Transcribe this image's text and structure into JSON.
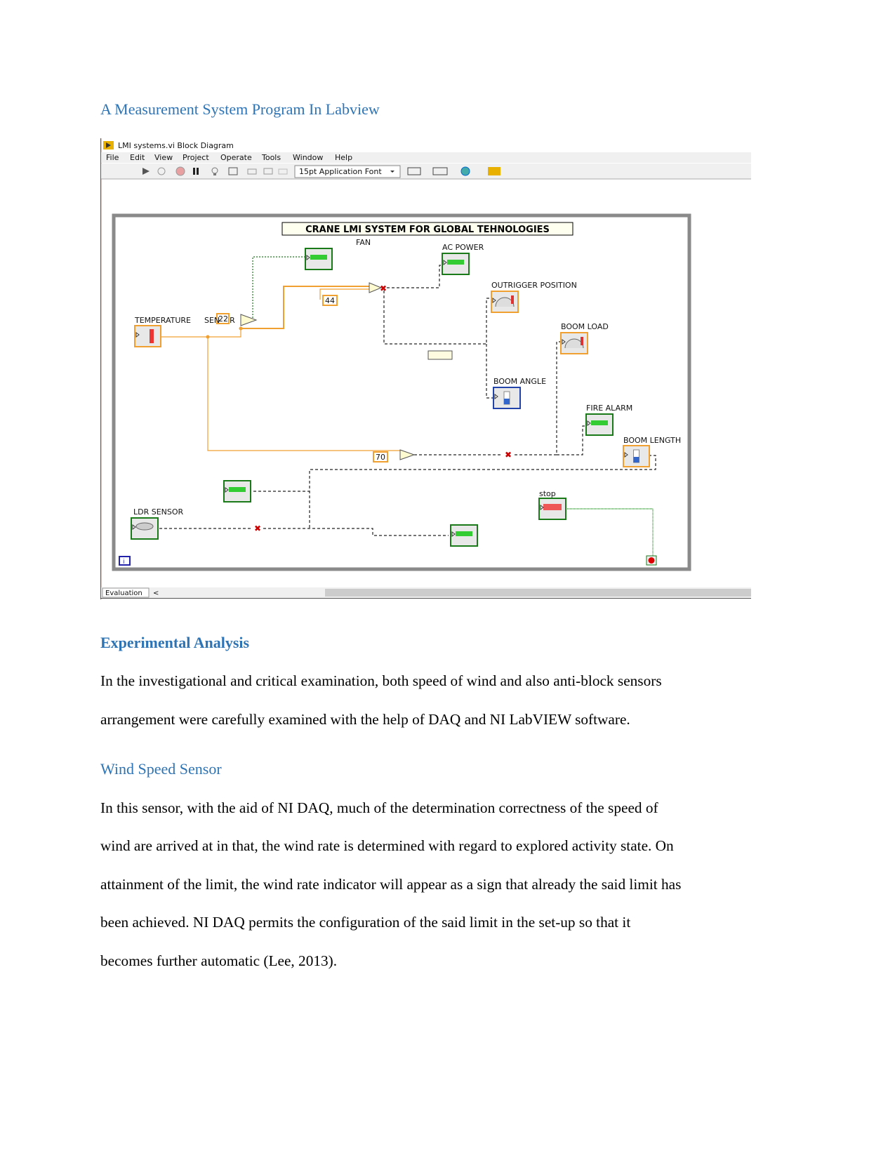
{
  "headings": {
    "main": "A Measurement System Program In Labview",
    "experimental": "Experimental Analysis",
    "wind": "Wind Speed Sensor"
  },
  "labview": {
    "window_title": "LMI systems.vi Block Diagram",
    "menu": [
      "File",
      "Edit",
      "View",
      "Project",
      "Operate",
      "Tools",
      "Window",
      "Help"
    ],
    "font_select": "15pt Application Font",
    "diagram_title": "CRANE LMI SYSTEM FOR GLOBAL TEHNOLOGIES",
    "labels": {
      "fan": "FAN",
      "ac_power": "AC POWER",
      "outrigger": "OUTRIGGER POSITION",
      "boom_load": "BOOM LOAD",
      "boom_angle": "BOOM ANGLE",
      "fire_alarm": "FIRE ALARM",
      "boom_length": "BOOM LENGTH",
      "temperature": "TEMPERATURE",
      "sensor": "SEN    R",
      "stop": "stop",
      "ldr": "LDR SENSOR"
    },
    "constants": {
      "c22": "22",
      "c44": "44",
      "c70": "70"
    },
    "status_tab": "Evaluation",
    "scroll_left": "<"
  },
  "paragraphs": {
    "experimental": [
      "In the investigational and critical examination, both speed of wind and also anti-block sensors",
      "arrangement were carefully examined with the help of DAQ and NI LabVIEW software."
    ],
    "wind": [
      "In this sensor, with the aid of NI DAQ, much of the determination correctness of the speed of",
      "wind are arrived at in that, the wind rate is determined with regard to explored activity state. On",
      "attainment of the limit, the wind rate indicator will appear as a sign that already the said limit has",
      "been achieved. NI DAQ permits the configuration of the said limit in the set-up so that it",
      "becomes further automatic (Lee, 2013)."
    ]
  },
  "colors": {
    "heading": "#2e74b5",
    "wire_orange": "#f0a030",
    "wire_green": "#1a7a1a",
    "frame": "#808080"
  }
}
